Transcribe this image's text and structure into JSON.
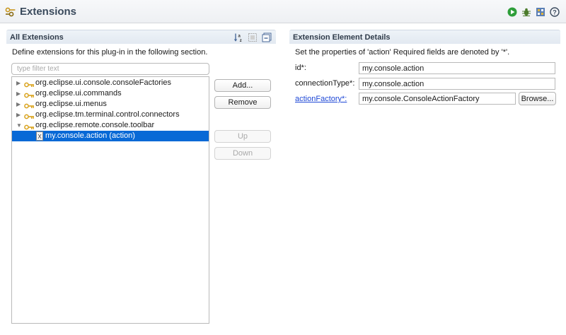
{
  "editor": {
    "title": "Extensions",
    "icon": "extensions-icon"
  },
  "toolbar": {
    "icons": [
      "run-icon",
      "debug-icon",
      "extension-wizard-icon",
      "help-icon"
    ],
    "colors": {
      "run": "#2e9e3a",
      "debug": "#4a7a2a",
      "help": "#3b4b5e"
    }
  },
  "left_panel": {
    "title": "All Extensions",
    "description": "Define extensions for this plug-in in the following section.",
    "filter": {
      "value": "",
      "placeholder": "type filter text"
    },
    "tools": [
      "sort-alpha-icon",
      "show-details-icon",
      "collapse-all-icon"
    ],
    "tree": [
      {
        "label": "org.eclipse.ui.console.consoleFactories",
        "expanded": false
      },
      {
        "label": "org.eclipse.ui.commands",
        "expanded": false
      },
      {
        "label": "org.eclipse.ui.menus",
        "expanded": false
      },
      {
        "label": "org.eclipse.tm.terminal.control.connectors",
        "expanded": false
      },
      {
        "label": "org.eclipse.remote.console.toolbar",
        "expanded": true
      }
    ],
    "child": {
      "label": "my.console.action (action)",
      "selected": true
    },
    "buttons": {
      "add": "Add...",
      "remove": "Remove",
      "up": "Up",
      "down": "Down"
    }
  },
  "right_panel": {
    "title": "Extension Element Details",
    "description": "Set the properties of 'action' Required fields are denoted by '*'.",
    "fields": {
      "id": {
        "label": "id*:",
        "value": "my.console.action"
      },
      "connection_type": {
        "label": "connectionType*:",
        "value": "my.console.action"
      },
      "action_factory": {
        "label": "actionFactory*:",
        "value": "my.console.ConsoleActionFactory"
      }
    },
    "browse_label": "Browse..."
  },
  "colors": {
    "selection": "#0869d6",
    "link": "#1d47d6",
    "plugin_icon": "#d9a21b"
  }
}
